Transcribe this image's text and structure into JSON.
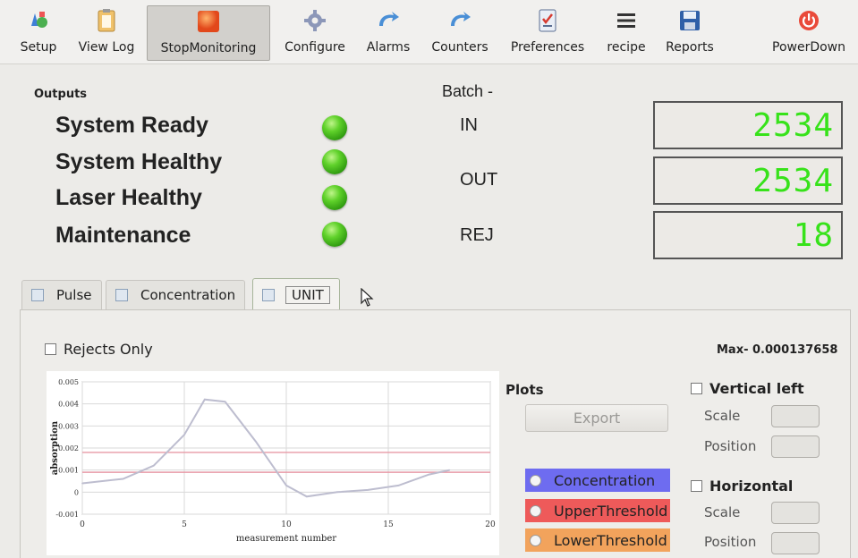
{
  "toolbar": {
    "items": [
      {
        "label": "Setup",
        "icon": "setup-icon"
      },
      {
        "label": "View Log",
        "icon": "clipboard-icon"
      },
      {
        "label": "StopMonitoring",
        "icon": "stop-icon"
      },
      {
        "label": "Configure",
        "icon": "gear-icon"
      },
      {
        "label": "Alarms",
        "icon": "alarm-icon"
      },
      {
        "label": "Counters",
        "icon": "counters-icon"
      },
      {
        "label": "Preferences",
        "icon": "checklist-icon"
      },
      {
        "label": "recipe",
        "icon": "menu-icon"
      },
      {
        "label": "Reports",
        "icon": "save-icon"
      },
      {
        "label": "PowerDown",
        "icon": "power-icon"
      }
    ],
    "active": "StopMonitoring"
  },
  "outputs": {
    "title": "Outputs",
    "items": [
      {
        "label": "System Ready",
        "status": "green"
      },
      {
        "label": "System Healthy",
        "status": "green"
      },
      {
        "label": "Laser Healthy",
        "status": "green"
      },
      {
        "label": "Maintenance",
        "status": "green"
      }
    ]
  },
  "batch": {
    "title": "Batch -",
    "counters": [
      {
        "label": "IN",
        "value": "2534"
      },
      {
        "label": "OUT",
        "value": "2534"
      },
      {
        "label": "REJ",
        "value": "18"
      }
    ]
  },
  "tabs": [
    {
      "label": "Pulse",
      "active": false
    },
    {
      "label": "Concentration",
      "active": false
    },
    {
      "label": "UNIT",
      "active": true
    }
  ],
  "panel": {
    "rejects_only_label": "Rejects Only",
    "max_text": "Max- 0.000137658",
    "plots_label": "Plots",
    "export_label": "Export",
    "plot_buttons": [
      {
        "label": "Concentration",
        "color": "#6e6cf0"
      },
      {
        "label": "UpperThreshold",
        "color": "#ee5a5a"
      },
      {
        "label": "LowerThreshold",
        "color": "#f2a35c"
      }
    ],
    "vertical": {
      "title": "Vertical left",
      "scale_label": "Scale",
      "position_label": "Position"
    },
    "horizontal": {
      "title": "Horizontal",
      "scale_label": "Scale",
      "position_label": "Position"
    }
  },
  "chart_data": {
    "type": "line",
    "xlabel": "measurement number",
    "ylabel": "absorption",
    "xlim": [
      0,
      20
    ],
    "ylim": [
      -0.001,
      0.005
    ],
    "x_ticks": [
      "0",
      "5",
      "10",
      "15",
      "20"
    ],
    "y_ticks": [
      "0.005",
      "0.004",
      "0.003",
      "0.002",
      "0.001",
      "0",
      "-0.001"
    ],
    "series": [
      {
        "color": "#bdbdcf",
        "x": [
          0,
          2,
          3.5,
          5,
          6,
          7,
          8.5,
          10,
          11,
          12.5,
          14,
          15.5,
          17,
          18
        ],
        "y": [
          0.0004,
          0.0006,
          0.0012,
          0.0026,
          0.0042,
          0.0041,
          0.0023,
          0.0003,
          -0.0002,
          0.0,
          0.0001,
          0.0003,
          0.0008,
          0.001
        ]
      }
    ],
    "thresholds": [
      {
        "color": "#e79aa6",
        "y": 0.0018
      },
      {
        "color": "#e79aa6",
        "y": 0.0009
      }
    ],
    "grid": true
  }
}
